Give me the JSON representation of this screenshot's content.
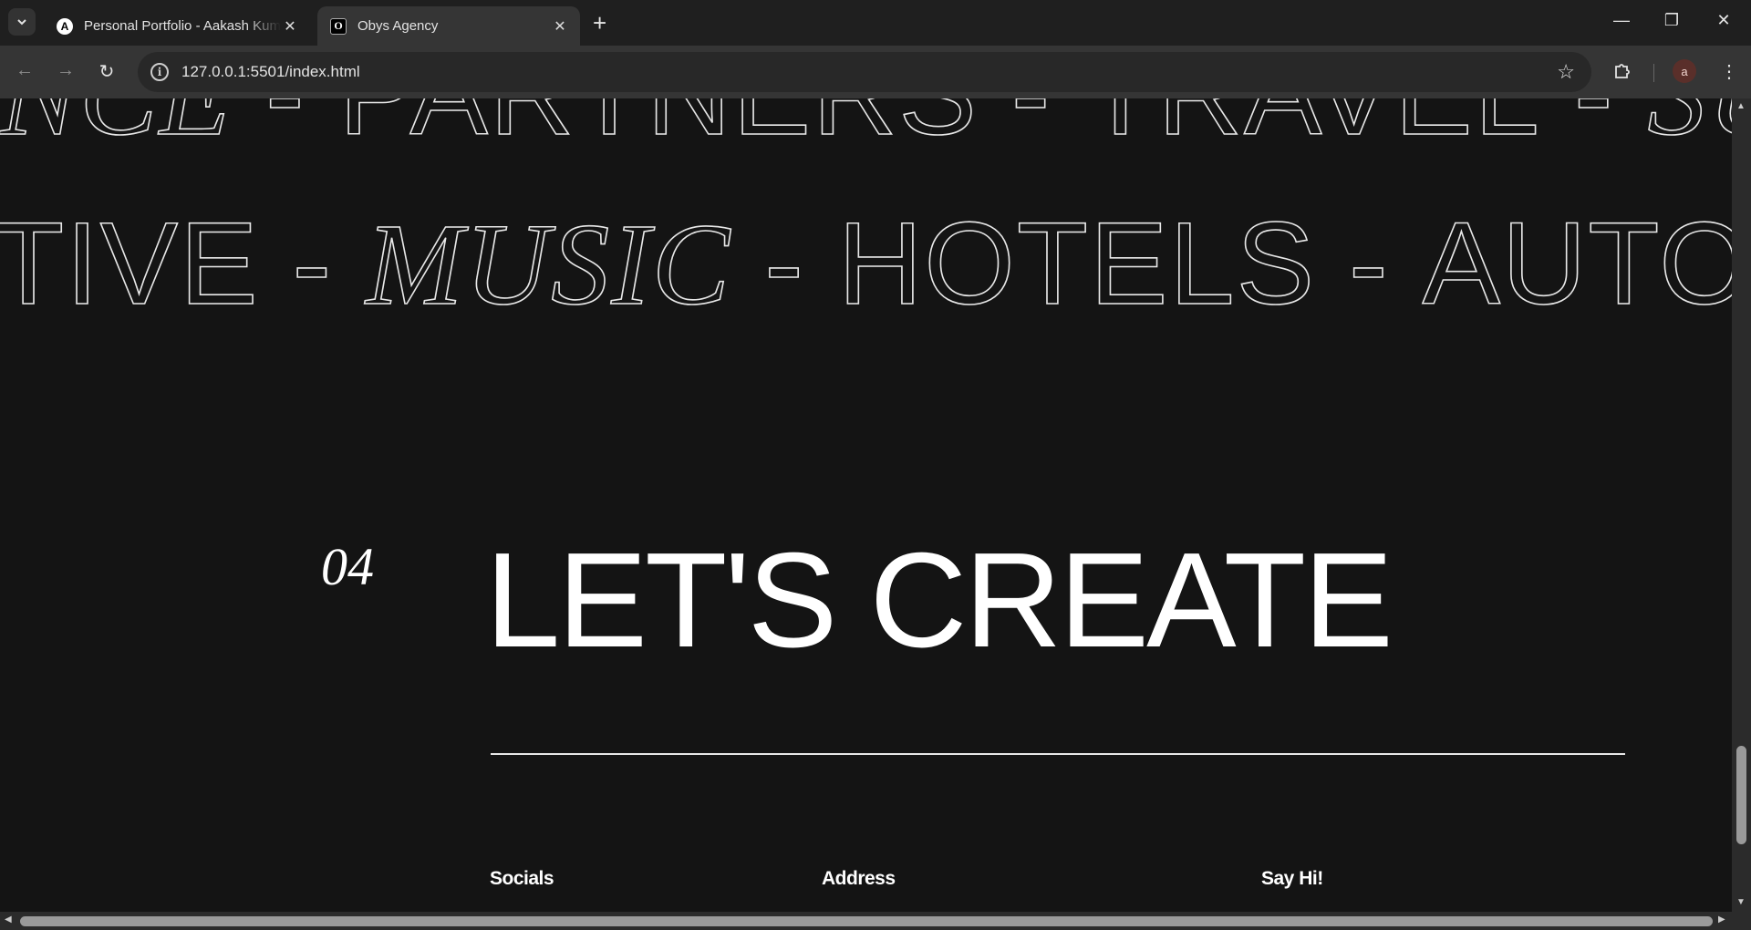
{
  "browser": {
    "tabs": [
      {
        "title": "Personal Portfolio - Aakash Kumar",
        "favicon": "A"
      },
      {
        "title": "Obys Agency",
        "favicon": "O"
      }
    ],
    "url": "127.0.0.1:5501/index.html",
    "profile_initial": "a"
  },
  "marquee": {
    "row1": [
      {
        "text": "NCE",
        "style": "italic"
      },
      {
        "text": "-",
        "style": "plain"
      },
      {
        "text": "PARTNERS",
        "style": "plain"
      },
      {
        "text": "-",
        "style": "plain"
      },
      {
        "text": "TRAVEL",
        "style": "plain"
      },
      {
        "text": "-",
        "style": "plain"
      },
      {
        "text": "SU",
        "style": "italic"
      }
    ],
    "row2": [
      {
        "text": "TIVE",
        "style": "plain"
      },
      {
        "text": "-",
        "style": "plain"
      },
      {
        "text": "MUSIC",
        "style": "italic"
      },
      {
        "text": "-",
        "style": "plain"
      },
      {
        "text": "HOTELS",
        "style": "plain"
      },
      {
        "text": "-",
        "style": "plain"
      },
      {
        "text": "AUTO",
        "style": "plain"
      }
    ]
  },
  "section": {
    "number": "04",
    "heading": "LET'S CREATE"
  },
  "footer_columns": {
    "socials": "Socials",
    "address": "Address",
    "say_hi": "Say Hi!"
  },
  "colors": {
    "background": "#141414",
    "text": "#ffffff",
    "outline": "#e8e8e8"
  }
}
